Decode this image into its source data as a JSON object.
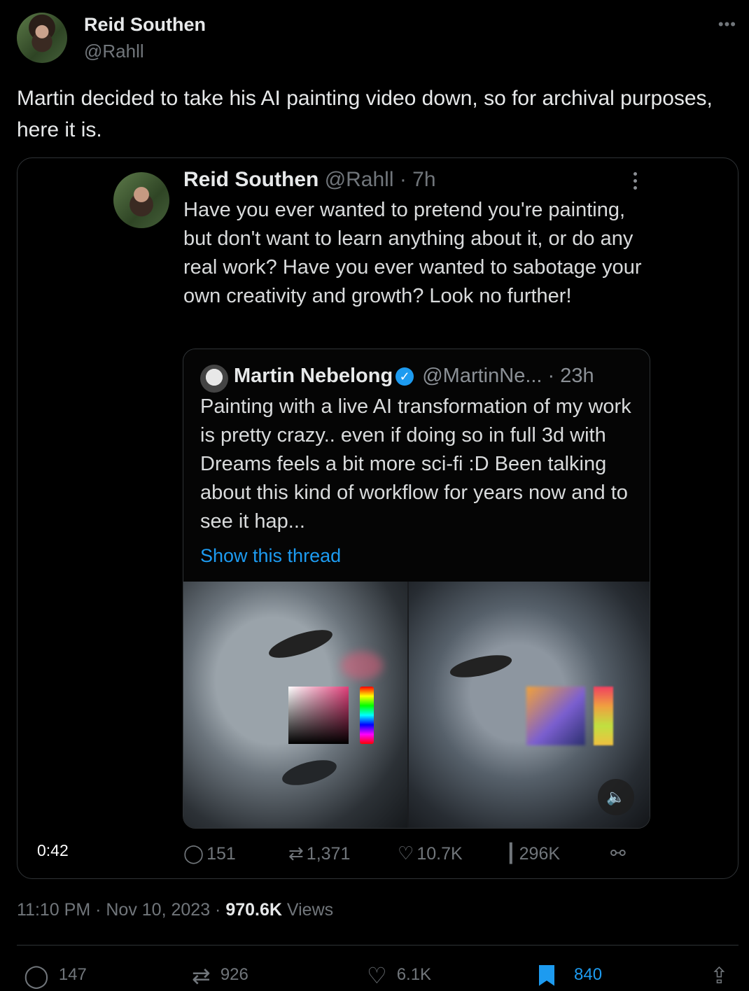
{
  "author": {
    "name": "Reid Southen",
    "handle": "@Rahll"
  },
  "tweet": {
    "text": "Martin decided to take his AI painting video down, so for archival purposes, here it is.",
    "time": "11:10 PM",
    "date": "Nov 10, 2023",
    "views_count": "970.6K",
    "views_label": "Views"
  },
  "more_icon": "•••",
  "media": {
    "duration": "0:42",
    "inner_tweet": {
      "name": "Reid Southen",
      "handle_time": "@Rahll · 7h",
      "text": "Have you ever wanted to pretend you're painting, but don't want to learn anything about it, or do any real work? Have you ever wanted to sabotage your own creativity and growth? Look no further!",
      "quote": {
        "name": "Martin Nebelong",
        "handle_time": "@MartinNe... · 23h",
        "text": "Painting with a live AI transformation of my work is pretty crazy.. even if doing so in full 3d with Dreams feels a bit more sci-fi :D Been talking about this kind of workflow for years now and to see it hap...",
        "show_thread": "Show this thread"
      },
      "actions": {
        "replies": "151",
        "retweets": "1,371",
        "likes": "10.7K",
        "views": "296K"
      }
    }
  },
  "actions": {
    "replies": "147",
    "retweets": "926",
    "likes": "6.1K",
    "bookmarks": "840"
  },
  "colors": {
    "background": "#000000",
    "accent": "#1d9bf0",
    "muted": "#71767b",
    "text": "#e7e9ea"
  }
}
